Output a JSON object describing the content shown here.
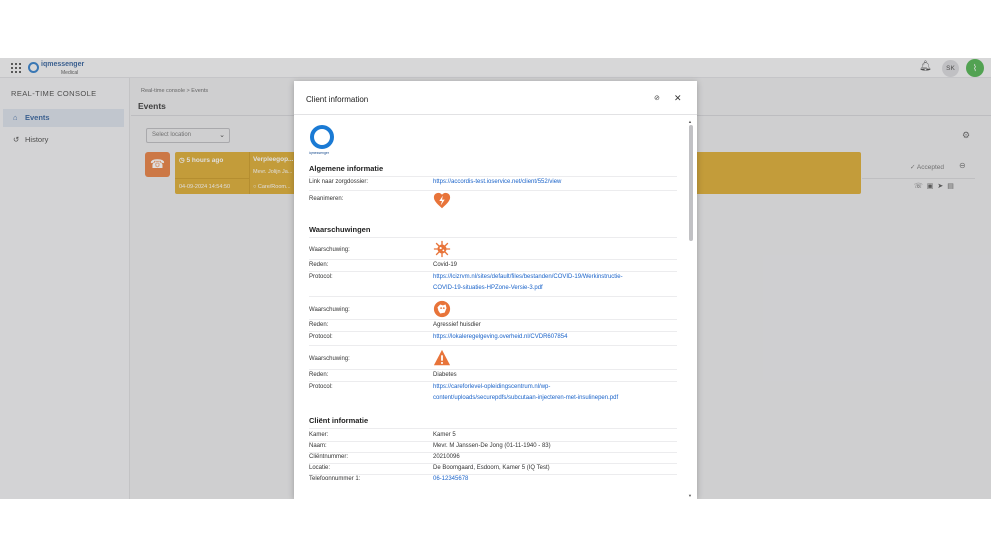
{
  "topbar": {
    "logo_text": "iqmessenger",
    "logo_subtext": "Medical",
    "avatar_initials": "SK",
    "icons": [
      "apps-grid-icon",
      "bell-icon",
      "activity-icon"
    ]
  },
  "sidebar": {
    "console_title": "REAL-TIME CONSOLE",
    "items": [
      {
        "label": "Events",
        "icon": "bell-icon",
        "active": true
      },
      {
        "label": "History",
        "icon": "history-icon",
        "active": false
      }
    ]
  },
  "main": {
    "breadcrumb": "Real-time console  >  Events",
    "title": "Events",
    "location_placeholder": "Select location"
  },
  "event": {
    "time_ago": "5 hours ago",
    "datetime": "04-09-2024 14:54:50",
    "type": "Verpleegop...",
    "client": "Mevr. Jolijn Ja...",
    "location": "Care/Room...",
    "status": "Accepted",
    "accent_color": "#d9a21b",
    "icon_color": "#e5712c"
  },
  "modal": {
    "title": "Client information",
    "logo_text": "iqmessenger",
    "general": {
      "title": "Algemene informatie",
      "link_label": "Link naar zorgdossier:",
      "link_value": "https://accordis-test.ioservice.net/client/552/view",
      "reanimate_label": "Reanimeren:"
    },
    "warnings": {
      "title": "Waarschuwingen",
      "items": [
        {
          "warning_label": "Waarschuwing:",
          "icon": "virus-warning-icon",
          "reason_label": "Reden:",
          "reason": "Covid-19",
          "protocol_label": "Protocol:",
          "protocol_line1": "https://lcizrvm.nl/sites/default/files/bestanden/COVID-19/Werkinstructie-",
          "protocol_line2": "COVID-19-situaties-HPZone-Versie-3.pdf"
        },
        {
          "warning_label": "Waarschuwing:",
          "icon": "aggressive-dog-warning-icon",
          "reason_label": "Reden:",
          "reason": "Agressief huisdier",
          "protocol_label": "Protocol:",
          "protocol_line1": "https://lokaleregelgeving.overheid.nl/CVDR607854",
          "protocol_line2": ""
        },
        {
          "warning_label": "Waarschuwing:",
          "icon": "warning-triangle-icon",
          "reason_label": "Reden:",
          "reason": "Diabetes",
          "protocol_label": "Protocol:",
          "protocol_line1": "https://careforlevel-opleidingscentrum.nl/wp-",
          "protocol_line2": "content/uploads/securepdfs/subcutaan-injecteren-met-insulinepen.pdf"
        }
      ]
    },
    "client": {
      "title": "Cliënt informatie",
      "rows": [
        {
          "label": "Kamer:",
          "value": "Kamer 5"
        },
        {
          "label": "Naam:",
          "value": "Mevr. M Janssen-De Jong (01-11-1940 - 83)"
        },
        {
          "label": "Cliëntnummer:",
          "value": "20210096"
        },
        {
          "label": "Locatie:",
          "value": "De Boomgaard, Esdoorn, Kamer 5 (IQ Test)"
        },
        {
          "label": "Telefoonnummer 1:",
          "value": "06-12345678"
        }
      ]
    }
  }
}
